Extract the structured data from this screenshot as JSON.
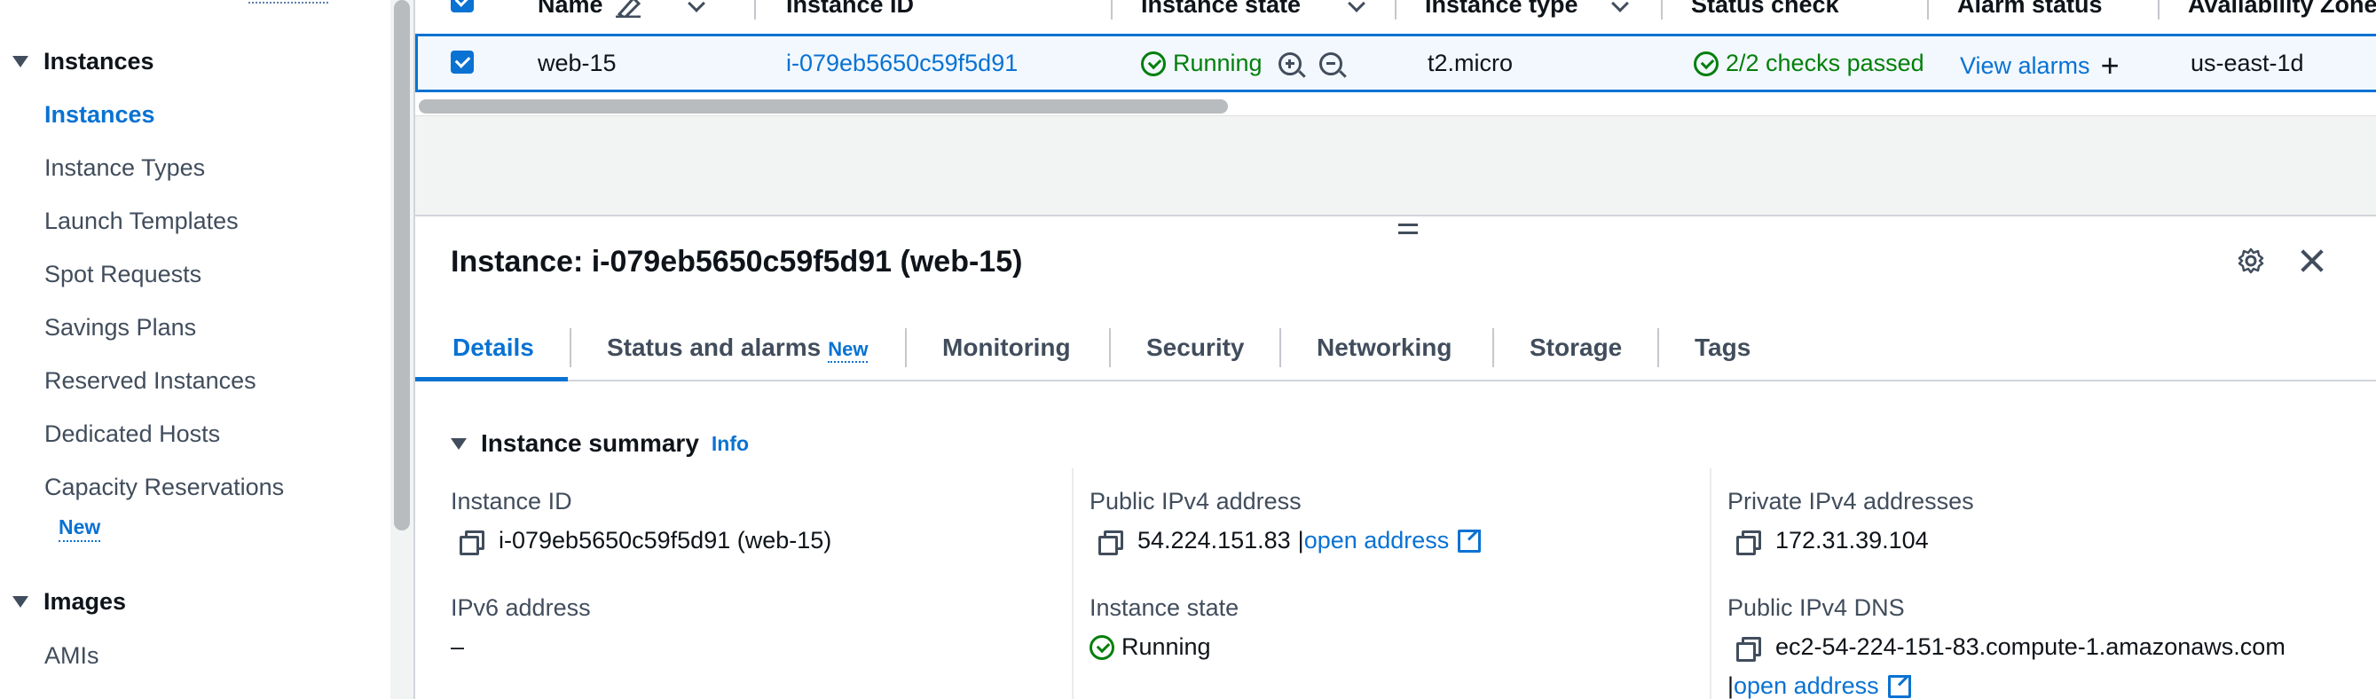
{
  "sidebar": {
    "groups": [
      {
        "label": "Instances"
      },
      {
        "label": "Images"
      }
    ],
    "items": [
      {
        "label": "Instances"
      },
      {
        "label": "Instance Types"
      },
      {
        "label": "Launch Templates"
      },
      {
        "label": "Spot Requests"
      },
      {
        "label": "Savings Plans"
      },
      {
        "label": "Reserved Instances"
      },
      {
        "label": "Dedicated Hosts"
      },
      {
        "label": "Capacity Reservations"
      },
      {
        "label": "AMIs"
      }
    ],
    "new_badge": "New"
  },
  "table": {
    "columns": [
      "Name",
      "Instance ID",
      "Instance state",
      "Instance type",
      "Status check",
      "Alarm status",
      "Availability Zone"
    ],
    "row": {
      "name": "web-15",
      "instance_id": "i-079eb5650c59f5d91",
      "state": "Running",
      "type": "t2.micro",
      "status_check": "2/2 checks passed",
      "alarm_status": "View alarms",
      "availability_zone": "us-east-1d"
    }
  },
  "panel": {
    "title": "Instance: i-079eb5650c59f5d91 (web-15)",
    "tabs": [
      {
        "label": "Details"
      },
      {
        "label": "Status and alarms",
        "badge": "New"
      },
      {
        "label": "Monitoring"
      },
      {
        "label": "Security"
      },
      {
        "label": "Networking"
      },
      {
        "label": "Storage"
      },
      {
        "label": "Tags"
      }
    ],
    "section": {
      "title": "Instance summary",
      "info": "Info"
    },
    "fields": {
      "instance_id": {
        "label": "Instance ID",
        "value": "i-079eb5650c59f5d91 (web-15)"
      },
      "public_ipv4": {
        "label": "Public IPv4 address",
        "value": "54.224.151.83",
        "sep": "|",
        "link": "open address"
      },
      "private_ipv4": {
        "label": "Private IPv4 addresses",
        "value": "172.31.39.104"
      },
      "ipv6": {
        "label": "IPv6 address",
        "value": "–"
      },
      "instance_state": {
        "label": "Instance state",
        "value": "Running"
      },
      "public_dns": {
        "label": "Public IPv4 DNS",
        "value": "ec2-54-224-151-83.compute-1.amazonaws.com",
        "sep": "|",
        "link": "open address"
      }
    }
  },
  "colors": {
    "accent": "#0972d3",
    "success": "#037f0c",
    "text": "#0f141a",
    "muted": "#414d5c"
  }
}
